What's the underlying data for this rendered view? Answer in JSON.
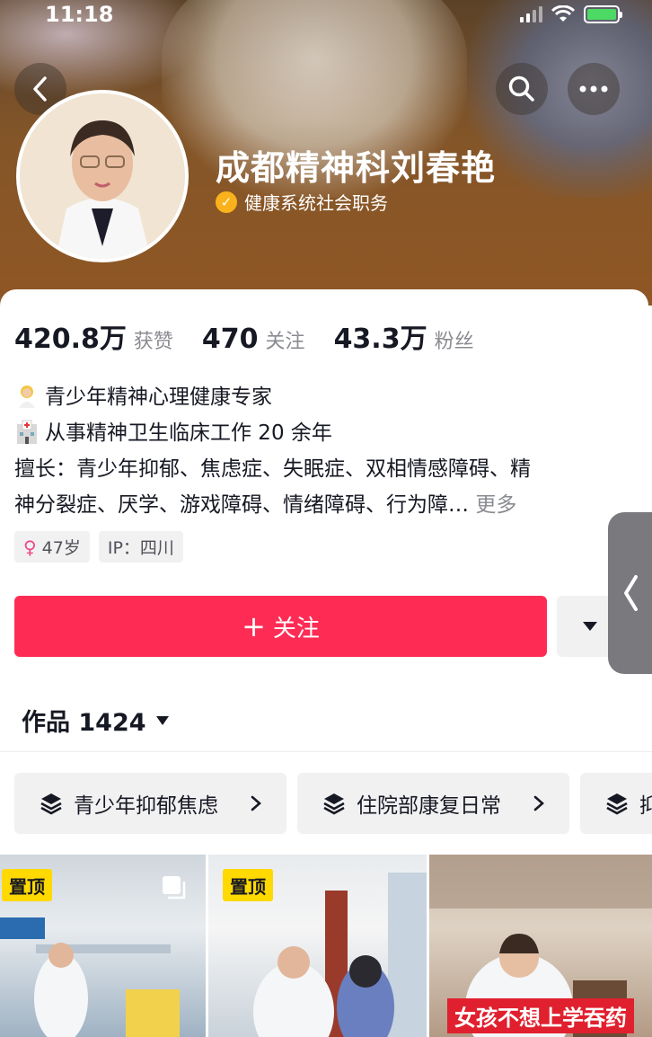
{
  "status_bar": {
    "time": "11:18"
  },
  "profile": {
    "name": "成都精神科刘春艳",
    "verification": "健康系统社会职务"
  },
  "stats": [
    {
      "value": "420.8万",
      "label": "获赞"
    },
    {
      "value": "470",
      "label": "关注"
    },
    {
      "value": "43.3万",
      "label": "粉丝"
    }
  ],
  "bio": {
    "line1": "青少年精神心理健康专家",
    "line2": "从事精神卫生临床工作 20 余年",
    "line3": "擅长：青少年抑郁、焦虑症、失眠症、双相情感障碍、精",
    "line4": "神分裂症、厌学、游戏障碍、情绪障碍、行为障…",
    "more": "更多"
  },
  "tags": {
    "age": "47岁",
    "ip": "IP：四川"
  },
  "actions": {
    "follow": "关注"
  },
  "works": {
    "label": "作品 1424"
  },
  "collections": [
    {
      "label": "青少年抑郁焦虑"
    },
    {
      "label": "住院部康复日常"
    },
    {
      "label": "抑"
    }
  ],
  "videos": [
    {
      "pin": "置顶"
    },
    {
      "pin": "置顶"
    },
    {
      "overlay": "女孩不想上学吞药"
    }
  ],
  "colors": {
    "accent": "#fe2c55",
    "verify": "#f9b21b",
    "pin": "#ffd900"
  }
}
